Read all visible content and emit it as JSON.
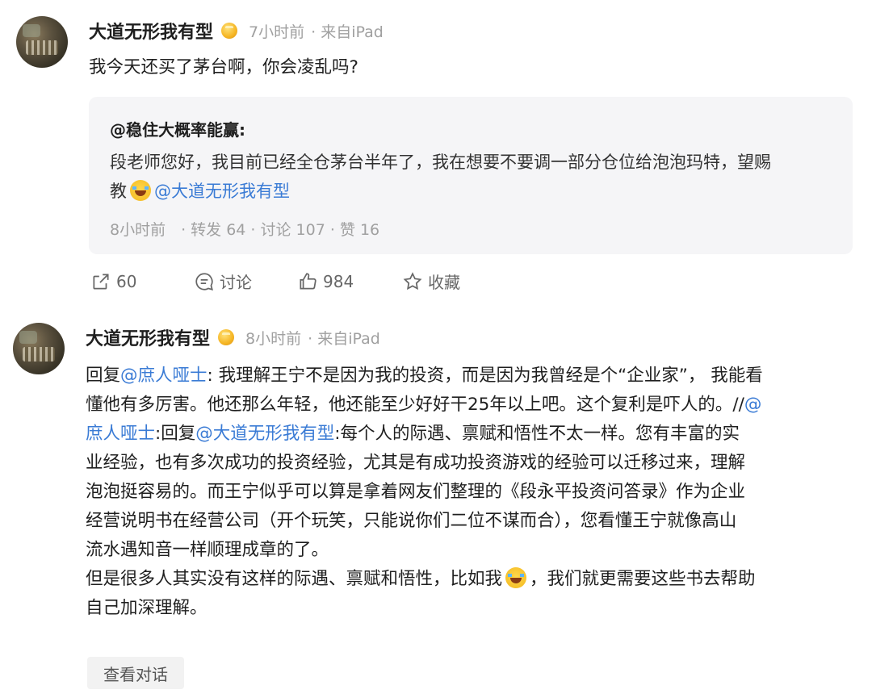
{
  "post1": {
    "username": "大道无形我有型",
    "time": "7小时前",
    "source": "· 来自iPad",
    "content": "我今天还买了茅台啊，你会凌乱吗?",
    "quote": {
      "author": "@稳住大概率能赢:",
      "text_main": "段老师您好，我目前已经全仓茅台半年了，我在想要不要调一部分仓位给泡泡玛特，望赐",
      "text_tail": "教",
      "mention": "@大道无形我有型",
      "meta": "8小时前　· 转发 64 · 讨论 107 · 赞 16"
    },
    "actions": {
      "share_count": "60",
      "comment_label": "讨论",
      "like_count": "984",
      "fav_label": "收藏"
    }
  },
  "post2": {
    "username": "大道无形我有型",
    "time": "8小时前",
    "source": "· 来自iPad",
    "lines": {
      "l1_a": "回复",
      "l1_mention": "@庶人哑士",
      "l1_b": ": 我理解王宁不是因为我的投资，而是因为我曾经是个“企业家”， 我能看",
      "l2_a": "懂他有多厉害。他还那么年轻，他还能至少好好干25年以上吧。这个复利是吓人的。//",
      "l2_mention": "@",
      "l3_mention": "庶人哑士",
      "l3_b": ":回复",
      "l3_mention2": "@大道无形我有型",
      "l3_c": ":每个人的际遇、禀赋和悟性不太一样。您有丰富的实",
      "l4": "业经验，也有多次成功的投资经验，尤其是有成功投资游戏的经验可以迁移过来，理解",
      "l5": "泡泡挺容易的。而王宁似乎可以算是拿着网友们整理的《段永平投资问答录》作为企业",
      "l6": "经营说明书在经营公司（开个玩笑，只能说你们二位不谋而合），您看懂王宁就像高山",
      "l7": "流水遇知音一样顺理成章的了。",
      "l8_a": "但是很多人其实没有这样的际遇、禀赋和悟性，比如我",
      "l8_b": "，我们就更需要这些书去帮助",
      "l9": "自己加深理解。"
    },
    "view_conversation": "查看对话"
  },
  "colors": {
    "mention": "#3a7bd5",
    "meta": "#a0a0a0",
    "quote_bg": "#f5f5f7"
  },
  "icons": [
    "verified-badge-icon",
    "share-icon",
    "comment-icon",
    "like-icon",
    "star-icon",
    "laugh-cry-emoji-icon"
  ]
}
